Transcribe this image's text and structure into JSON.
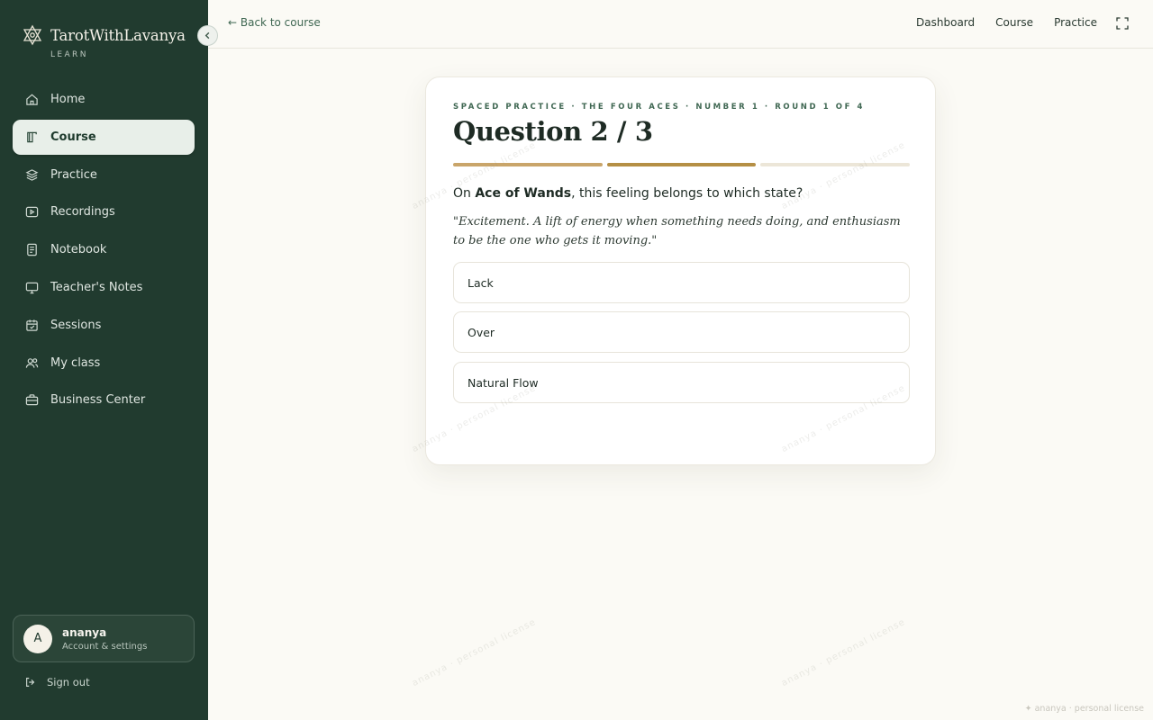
{
  "brand": {
    "title": "TarotWithLavanya",
    "subtitle": "LEARN"
  },
  "sidebar": {
    "items": [
      {
        "label": "Home",
        "icon": "home-icon",
        "active": false
      },
      {
        "label": "Course",
        "icon": "book-icon",
        "active": true
      },
      {
        "label": "Practice",
        "icon": "layers-icon",
        "active": false
      },
      {
        "label": "Recordings",
        "icon": "play-icon",
        "active": false
      },
      {
        "label": "Notebook",
        "icon": "notebook-icon",
        "active": false
      },
      {
        "label": "Teacher's Notes",
        "icon": "monitor-icon",
        "active": false
      },
      {
        "label": "Sessions",
        "icon": "calendar-icon",
        "active": false
      },
      {
        "label": "My class",
        "icon": "users-icon",
        "active": false
      },
      {
        "label": "Business Center",
        "icon": "briefcase-icon",
        "active": false
      }
    ]
  },
  "account": {
    "initial": "A",
    "name": "ananya",
    "subtitle": "Account & settings"
  },
  "signout": {
    "label": "Sign out"
  },
  "topbar": {
    "back_label": "← Back to course",
    "nav": [
      "Dashboard",
      "Course",
      "Practice"
    ]
  },
  "quiz": {
    "eyebrow": "SPACED PRACTICE · THE FOUR ACES · NUMBER 1 · ROUND 1 OF 4",
    "title": "Question 2 / 3",
    "progress": {
      "current": 2,
      "total": 3
    },
    "prompt_prefix": "On ",
    "prompt_card": "Ace of Wands",
    "prompt_suffix": ", this feeling belongs to which state?",
    "quote": "\"Excitement. A lift of energy when something needs doing, and enthusiasm to be the one who gets it moving.\"",
    "options": [
      "Lack",
      "Over",
      "Natural Flow"
    ]
  },
  "watermark": "ananya · personal license",
  "license": "✦ ananya · personal license",
  "colors": {
    "sidebar_bg": "#213b2f",
    "accent_green": "#3f6752",
    "progress_done": "#c9a56a",
    "progress_current": "#b58f45",
    "progress_pending": "#ece6d8"
  }
}
